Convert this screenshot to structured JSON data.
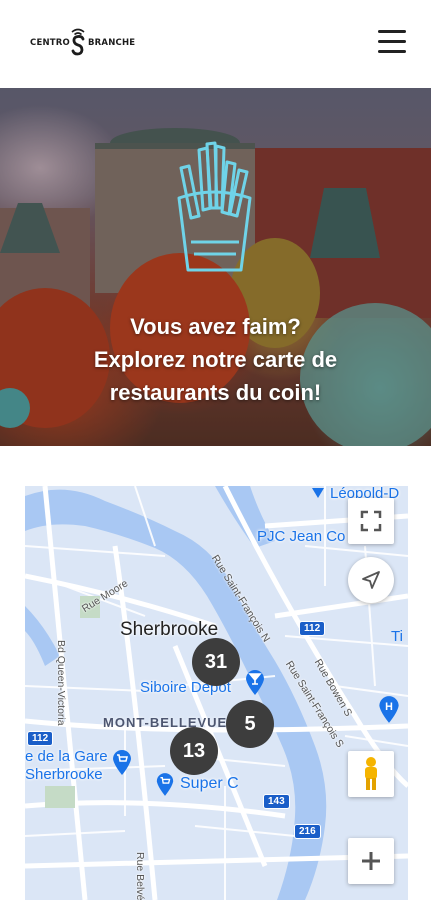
{
  "header": {
    "logo_left": "CENTRO",
    "logo_right": "BRANCHE",
    "logo_icon": "s-wifi-logo-icon",
    "menu_icon": "hamburger-menu-icon"
  },
  "hero": {
    "line1": "Vous avez faim?",
    "line2": "Explorez notre carte de",
    "line3": "restaurants du coin!",
    "icon": "fries-icon"
  },
  "map": {
    "city": "Sherbrooke",
    "district": "MONT-BELLEVUE",
    "places": {
      "siboire": "Siboire Depot",
      "gare_line1": "e de la Gare",
      "gare_line2": "Sherbrooke",
      "superc": "Super C",
      "pjc": "PJC Jean Co",
      "leopold": "Léopold-D",
      "ti": "Ti"
    },
    "streets": {
      "moore": "Rue Moore",
      "queen_victoria": "Bd Queen-Victoria",
      "st_francois_n": "Rue Saint-François N",
      "st_francois_s": "Rue Saint-François S",
      "bowen": "Rue Bowen S",
      "belvedere": "Rue Belvéd"
    },
    "route_shields": [
      "112",
      "112",
      "143",
      "216"
    ],
    "clusters": [
      "31",
      "5",
      "13"
    ],
    "controls": {
      "fullscreen": "fullscreen-icon",
      "location": "location-arrow-icon",
      "pegman": "pegman-icon",
      "zoom_in": "plus-icon"
    },
    "colors": {
      "water": "#a9c8f3",
      "land": "#dbe6f6",
      "road": "#ffffff",
      "cluster": "#3d3d3d",
      "poi": "#1a73e8"
    }
  }
}
